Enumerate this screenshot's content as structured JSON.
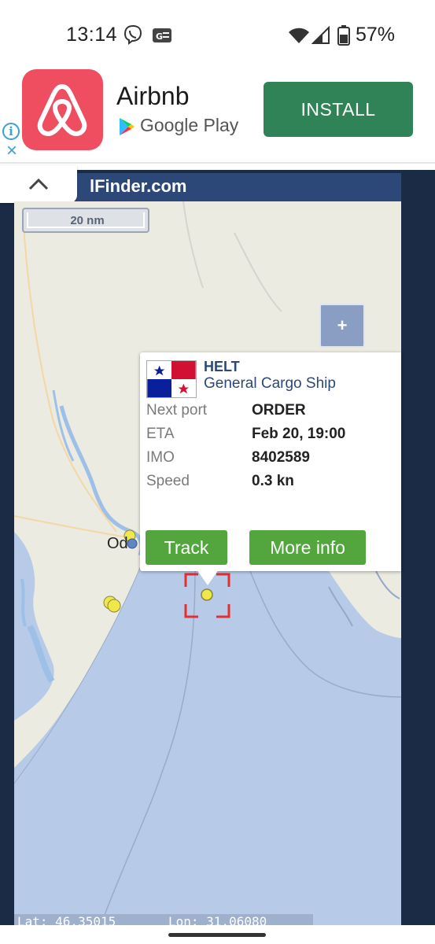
{
  "status_bar": {
    "time": "13:14",
    "battery": "57%",
    "icons": [
      "viber-icon",
      "g-news-icon",
      "wifi-icon",
      "signal-icon",
      "battery-icon"
    ]
  },
  "ad": {
    "app_name": "Airbnb",
    "store": "Google Play",
    "install_label": "INSTALL",
    "info_icon": "i",
    "close_icon": "×",
    "colors": {
      "logo_bg": "#ee4e5f",
      "install_bg": "#2f8356"
    }
  },
  "site": {
    "title_fragment": "lFinder.com",
    "collapse_icon": "chevron-up-icon"
  },
  "map": {
    "scale_label": "20 nm",
    "zoom_in_label": "+",
    "city_label": "Od",
    "lat_text": "Lat: 46.35015",
    "lon_text": "Lon: 31.06080"
  },
  "popup": {
    "vessel_name": "HELT",
    "vessel_type": "General Cargo Ship",
    "flag": "panama-flag",
    "rows": [
      {
        "label": "Next port",
        "value": "ORDER"
      },
      {
        "label": "ETA",
        "value": "Feb 20, 19:00"
      },
      {
        "label": "IMO",
        "value": "8402589"
      },
      {
        "label": "Speed",
        "value": "0.3 kn"
      }
    ],
    "track_label": "Track",
    "more_info_label": "More info",
    "colors": {
      "button": "#52a63d",
      "title": "#2b4878"
    }
  }
}
